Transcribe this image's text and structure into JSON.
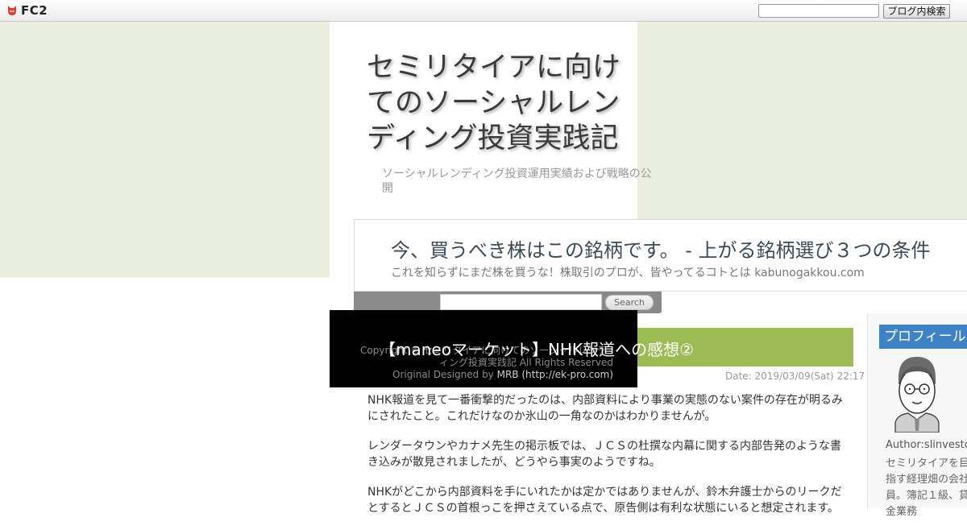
{
  "fc2_bar": {
    "logo_text": "FC2",
    "search_placeholder": "",
    "search_button": "ブログ内検索"
  },
  "blog": {
    "title": "セミリタイアに向けてのソーシャルレンディング投資実践記",
    "subtitle": "ソーシャルレンディング投資運用実績および戦略の公開"
  },
  "ad": {
    "title": "今、買うべき株はこの銘柄です。 - 上がる銘柄選び３つの条件",
    "description": "これを知らずにまだ株を買うな！株取引のプロが、皆やってるコトとは kabunogakkou.com"
  },
  "search": {
    "placeholder": "",
    "button": "Search"
  },
  "article": {
    "title": "【maneoマーケット】NHK報道への感想②",
    "date": "Date: 2019/03/09(Sat) 22:17",
    "paragraphs": [
      " NHK報道を見て一番衝撃的だったのは、内部資料により事業の実態のない案件の存在が明るみにされたこと。これだけなのか氷山の一角なのかはわかりませんが。",
      "レンダータウンやカナメ先生の掲示板では、ＪＣＳの杜撰な内幕に関する内部告発のような書き込みが散見されましたが、どうやら事実のようですね。",
      "NHKがどこから内部資料を手にいれたかは定かではありませんが、鈴木弁護士からのリークだとするとＪＣＳの首根っこを押さえている点で、原告側は有利な状態にいると想定されます。"
    ]
  },
  "copyright": {
    "line1": "Copyright © セミリタイアに向けてのソーシャルレンデ",
    "line2": "ィング投資実践記 All Rights Reserved",
    "line3_prefix": "Original Designed by ",
    "line3_link": "MRB (http://ek-pro.com)"
  },
  "sidebar": {
    "profile_heading": "プロフィール",
    "author": "Author:slinvestor",
    "bio": "セミリタイアを目指す経理畑の会社員。簿記１級、貸金業務"
  },
  "colors": {
    "panel_bg": "#ebefdf",
    "article_header": "#9cbb55",
    "profile_header": "#3f83c7"
  }
}
